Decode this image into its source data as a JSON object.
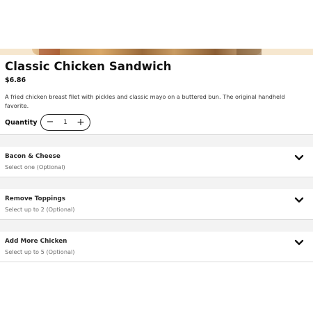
{
  "item": {
    "title": "Classic Chicken Sandwich",
    "price": "$6.86",
    "description": "A fried chicken breast filet with pickles and classic mayo on a buttered bun. The original handheld favorite."
  },
  "quantity": {
    "label": "Quantity",
    "value": "1",
    "minus": "−",
    "plus": "+"
  },
  "options": [
    {
      "name": "Bacon & Cheese",
      "sub": "Select one (Optional)"
    },
    {
      "name": "Remove Toppings",
      "sub": "Select up to 2 (Optional)"
    },
    {
      "name": "Add More Chicken",
      "sub": "Select up to 5 (Optional)"
    }
  ],
  "icons": {
    "option_toggle": "chevron-down-icon",
    "decrease": "minus-icon",
    "increase": "plus-icon"
  }
}
